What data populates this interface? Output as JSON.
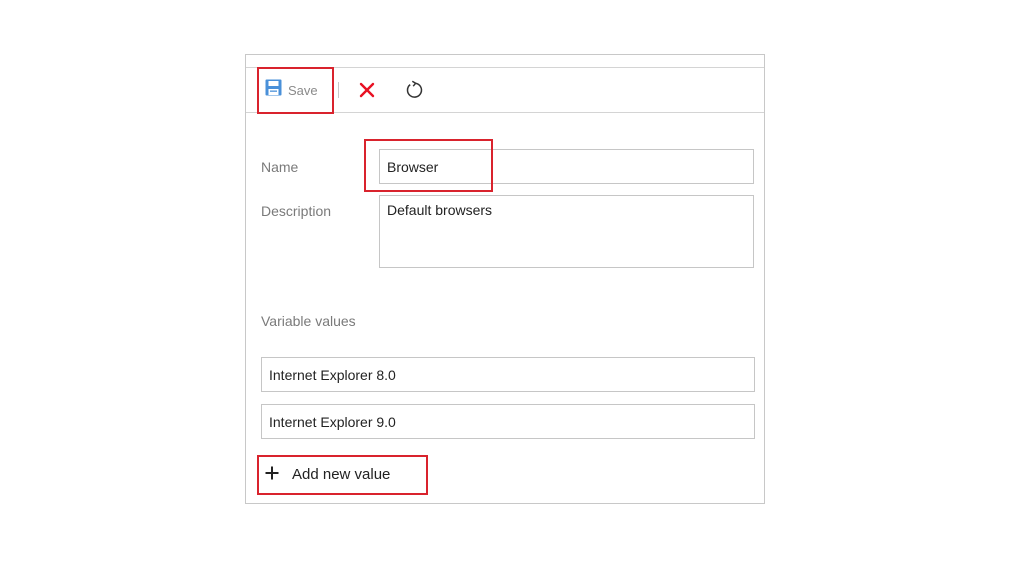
{
  "toolbar": {
    "save_label": "Save",
    "save_icon": "floppy-disk-icon",
    "discard_icon": "close-icon",
    "refresh_icon": "refresh-icon"
  },
  "form": {
    "name_label": "Name",
    "name_value": "Browser",
    "description_label": "Description",
    "description_value": "Default browsers",
    "variable_values_label": "Variable values",
    "values": [
      "Internet Explorer 8.0",
      "Internet Explorer 9.0"
    ],
    "add_new_value_label": "Add new value",
    "add_icon": "plus-icon"
  },
  "colors": {
    "highlight": "#d9232d",
    "save_icon": "#4a90d9",
    "discard_icon": "#e81123"
  }
}
